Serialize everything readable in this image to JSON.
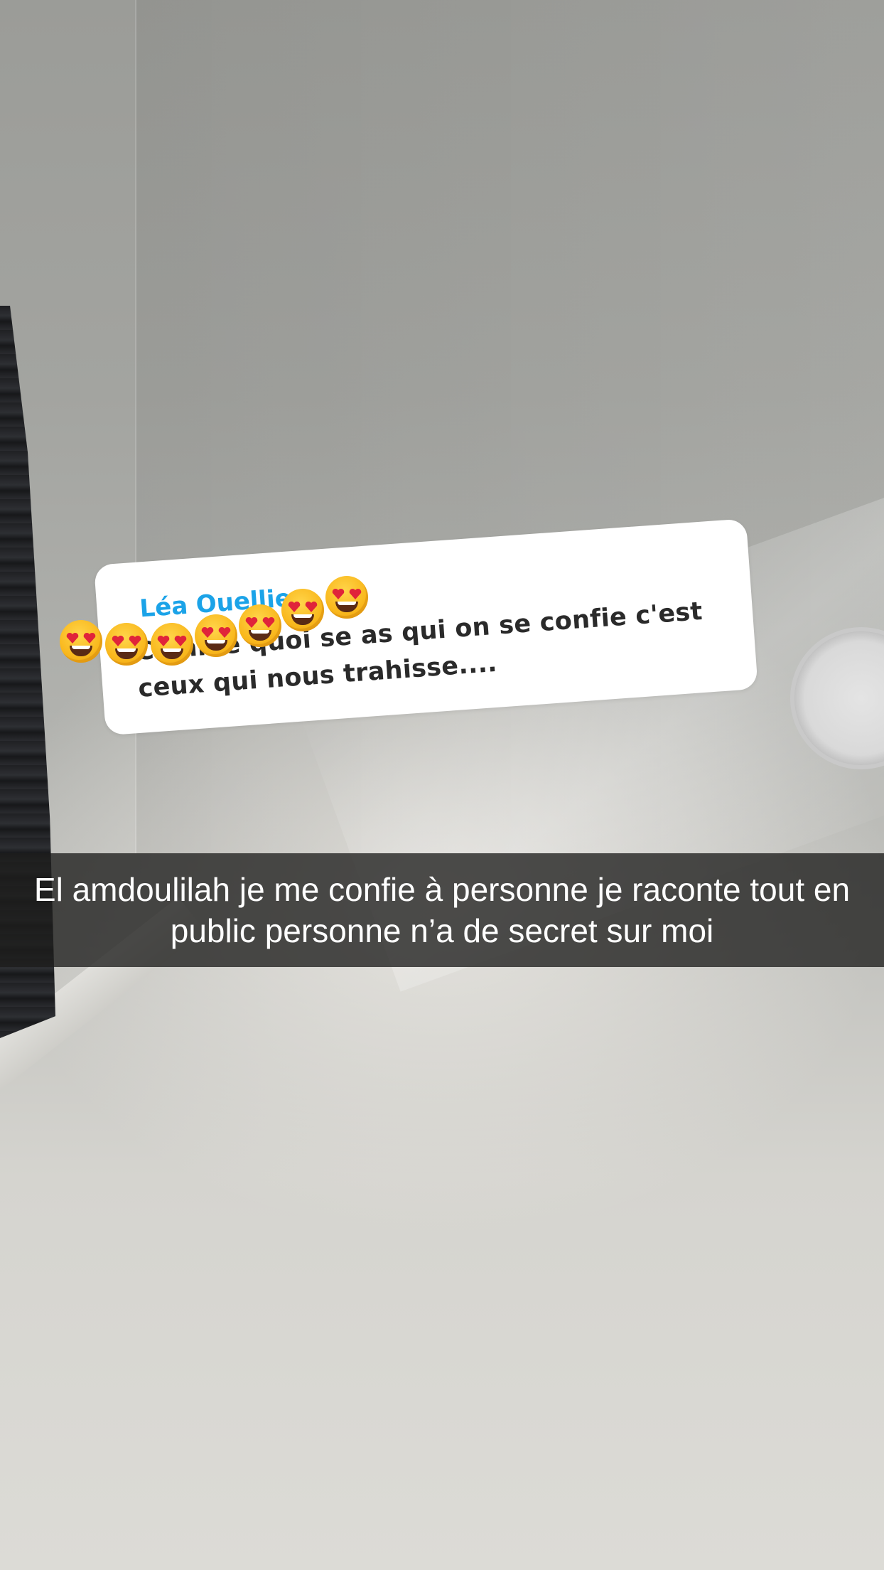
{
  "question_sticker": {
    "author": "Léa Ouellier",
    "text": "Comme quoi se as qui on se confie c'est ceux qui nous trahisse...."
  },
  "emojis": [
    {
      "icon": "heart-eyes-emoji"
    },
    {
      "icon": "heart-eyes-emoji"
    },
    {
      "icon": "heart-eyes-emoji"
    },
    {
      "icon": "heart-eyes-emoji"
    },
    {
      "icon": "heart-eyes-emoji"
    },
    {
      "icon": "heart-eyes-emoji"
    },
    {
      "icon": "heart-eyes-emoji"
    }
  ],
  "caption": {
    "text": "El amdoulilah je me confie à personne je raconte tout en public personne n’a de secret sur moi",
    "background_color": "#2e2e2b"
  },
  "colors": {
    "author_accent": "#1ba3e8",
    "question_text": "#2a2a2a",
    "card_background": "#ffffff"
  }
}
